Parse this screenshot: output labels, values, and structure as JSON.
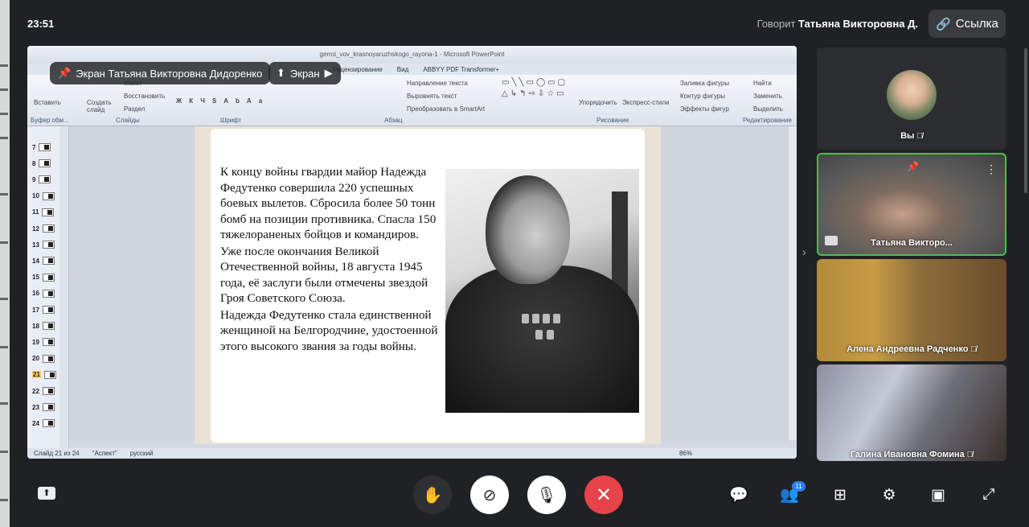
{
  "header": {
    "time": "23:51",
    "speaker_prefix": "Говорит",
    "speaker_name": "Татьяна Викторовна Д.",
    "link_label": "Ссылка"
  },
  "screen_share": {
    "pinned_label": "Экран Татьяна Викторовна Дидоренко",
    "screen_label": "Экран",
    "window_title": "gerroi_vov_krasnoyaruzhskogo_rayona-1 - Microsoft PowerPoint",
    "ribbon_tabs": [
      "Рецензирование",
      "Вид",
      "ABBYY PDF Transformer+"
    ],
    "ribbon_groups": [
      "Буфер обм...",
      "Слайды",
      "Шрифт",
      "Абзац",
      "Рисование",
      "Редактирование"
    ],
    "ribbon_items": {
      "insert": "Вставить",
      "create_slide": "Создать слайд",
      "layout": "Макет",
      "restore": "Восстановить",
      "section": "Раздел",
      "text_direction": "Направление текста",
      "align_text": "Выровнять текст",
      "smartart": "Преобразовать в SmartArt",
      "arrange": "Упорядочить",
      "quick_styles": "Экспресс-стили",
      "shape_fill": "Заливка фигуры",
      "shape_outline": "Контур фигуры",
      "shape_effects": "Эффекты фигур",
      "find": "Найти",
      "replace": "Заменить",
      "select": "Выделить"
    },
    "thumbnails": [
      "7",
      "8",
      "9",
      "10",
      "11",
      "12",
      "13",
      "14",
      "15",
      "16",
      "17",
      "18",
      "19",
      "20",
      "21",
      "22",
      "23",
      "24"
    ],
    "active_thumbnail": "21",
    "slide_paragraphs": [
      "К концу войны гвардии майор Надежда Федутенко совершила 220 успешных боевых вылетов. Сбросила более 50 тонн бомб на позиции противника. Спасла 150 тяжелораненых бойцов и командиров.",
      "Уже после окончания Великой Отечественной войны, 18 августа 1945 года, её заслуги были отмечены звездой Гроя Советского Союза.",
      "Надежда Федутенко стала единственной женщиной на Белгородчине, удостоенной этого высокого звания за годы войны."
    ],
    "status_slide": "Слайд 21 из 24",
    "status_theme": "\"Аспект\"",
    "status_lang": "русский",
    "status_zoom": "86%"
  },
  "participants": [
    {
      "name": "Вы",
      "muted": true
    },
    {
      "name": "Татьяна Викторо...",
      "muted": false
    },
    {
      "name": "Алена Андреевна Радченко",
      "muted": true
    },
    {
      "name": "Галина Ивановна Фомина",
      "muted": true
    }
  ],
  "controls": {
    "participants_count": "11",
    "mute_glyph": "🎙̸",
    "colors": {
      "end_call": "#e6434a",
      "badge": "#2d7ff9",
      "active_border": "#46c04d"
    }
  }
}
